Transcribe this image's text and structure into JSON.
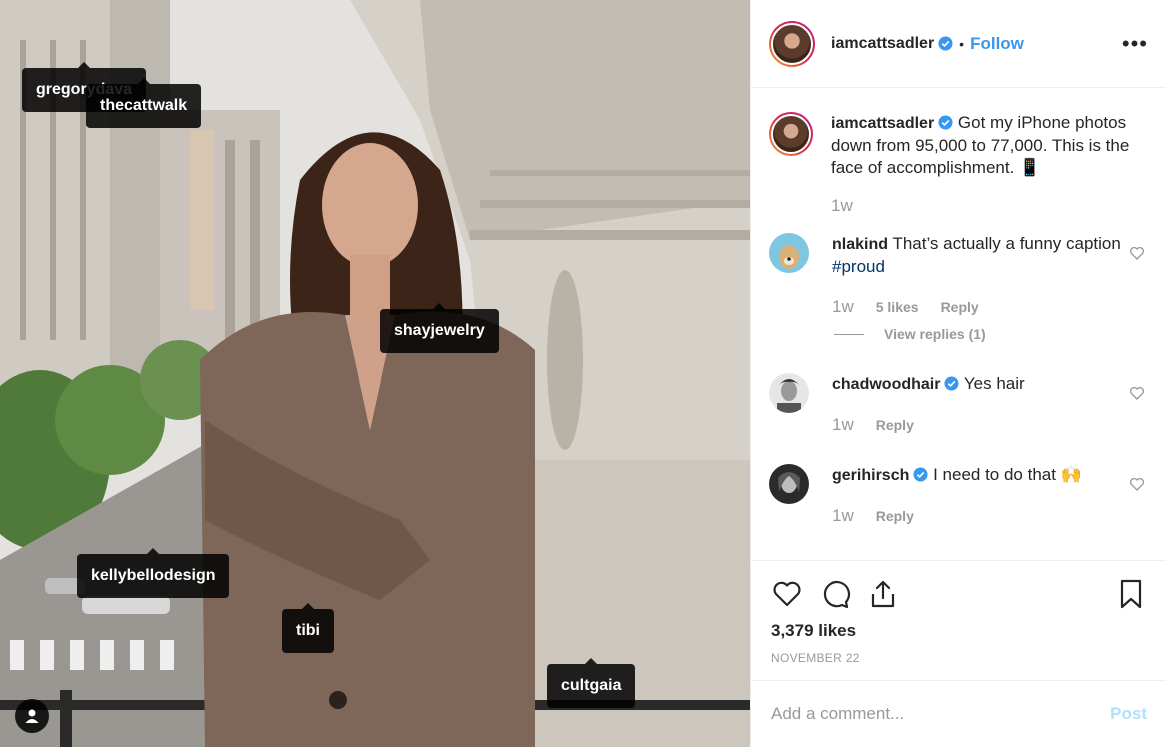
{
  "post": {
    "author": "iamcattsadler",
    "verified": true,
    "follow_label": "Follow",
    "separator": "•",
    "more_label": "•••",
    "caption": "Got my iPhone photos down from 95,000 to 77,000. This is the face of accomplishment. 📱",
    "caption_time": "1w",
    "likes": "3,379 likes",
    "date": "NOVEMBER 22"
  },
  "photo_tags": [
    {
      "name": "gregorydava"
    },
    {
      "name": "thecattwalk"
    },
    {
      "name": "shayjewelry"
    },
    {
      "name": "kellybellodesign"
    },
    {
      "name": "tibi"
    },
    {
      "name": "cultgaia"
    }
  ],
  "comments": [
    {
      "user": "nlakind",
      "verified": false,
      "text": "That’s actually a funny caption ",
      "hashtag": "#proud",
      "time": "1w",
      "likes": "5 likes",
      "reply_label": "Reply",
      "view_replies": "View replies (1)"
    },
    {
      "user": "chadwoodhair",
      "verified": true,
      "text": "Yes hair",
      "time": "1w",
      "reply_label": "Reply"
    },
    {
      "user": "gerihirsch",
      "verified": true,
      "text": "I need to do that 🙌",
      "time": "1w",
      "reply_label": "Reply"
    }
  ],
  "comment_box": {
    "placeholder": "Add a comment...",
    "post_label": "Post"
  },
  "colors": {
    "accent": "#3897f0",
    "post_disabled": "#b2dffc",
    "muted": "#999999"
  },
  "icons": [
    "heart-icon",
    "comment-icon",
    "share-icon",
    "bookmark-icon",
    "user-tags-icon",
    "verified-badge-icon",
    "more-options-icon"
  ]
}
